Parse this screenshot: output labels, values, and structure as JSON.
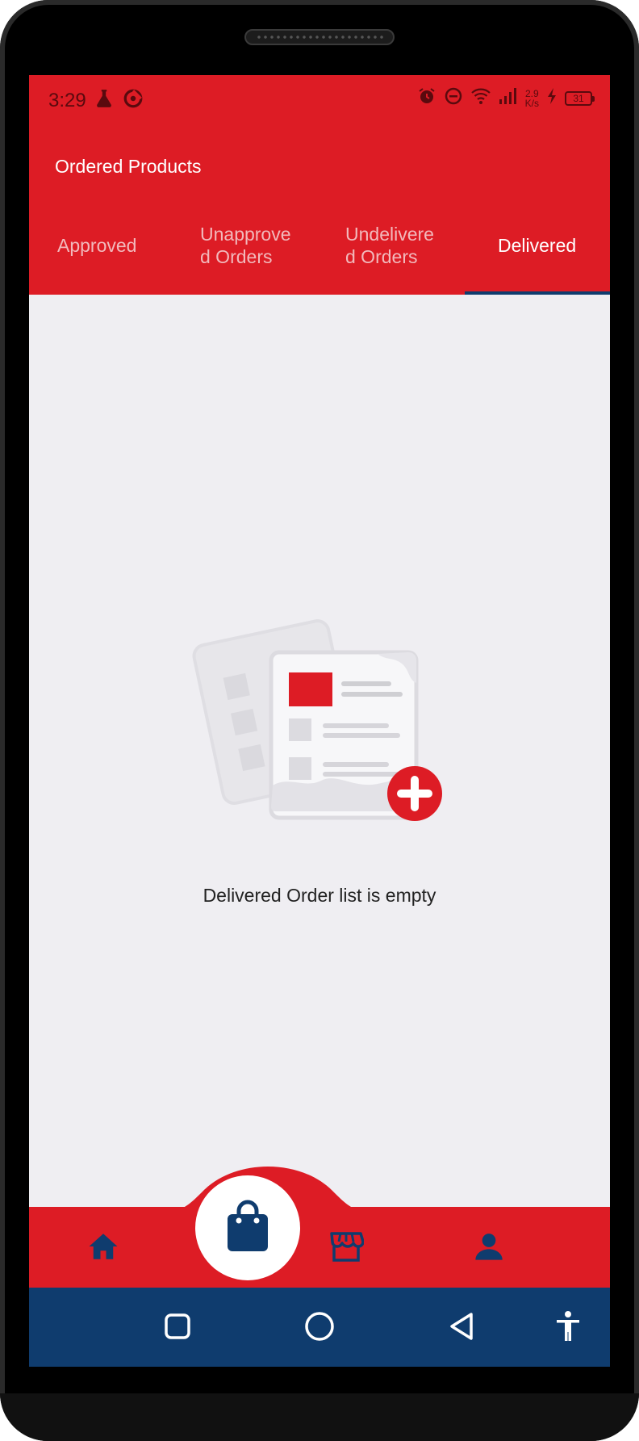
{
  "status_bar": {
    "time": "3:29",
    "net_speed_value": "2.9",
    "net_speed_unit": "K/s",
    "battery": "31",
    "left_icons": [
      "flask-icon",
      "data-saver-icon"
    ],
    "right_icons": [
      "alarm-icon",
      "do-not-disturb-icon",
      "wifi-icon",
      "signal-icon",
      "charging-icon"
    ]
  },
  "app_bar": {
    "title": "Ordered Products"
  },
  "tabs": [
    {
      "label": "Approved",
      "active": false
    },
    {
      "label": "Unapprove\nd Orders",
      "active": false
    },
    {
      "label": "Undelivere\nd Orders",
      "active": false
    },
    {
      "label": "Delivered",
      "active": true
    }
  ],
  "empty_state": {
    "message": "Delivered Order list is empty",
    "illustration": "empty-order-list-illustration"
  },
  "bottom_nav": {
    "items": [
      "home-icon",
      "shopping-bag-icon",
      "store-icon",
      "profile-icon"
    ],
    "active": "shopping-bag-icon"
  },
  "system_nav": [
    "recents-icon",
    "home-circle-icon",
    "back-icon",
    "accessibility-icon"
  ],
  "colors": {
    "primary_red": "#dd1c25",
    "navy": "#0f3c6e",
    "background": "#efeef2"
  }
}
